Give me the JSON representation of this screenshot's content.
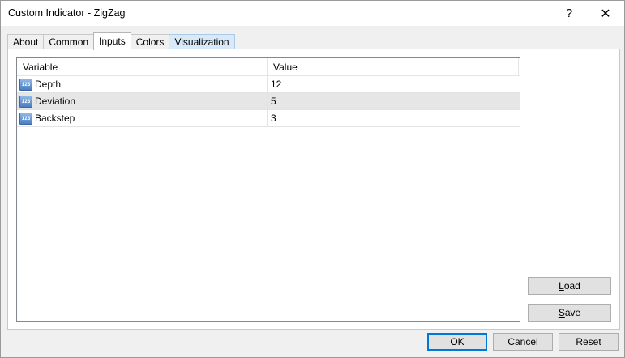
{
  "window": {
    "title": "Custom Indicator - ZigZag",
    "help_glyph": "?",
    "close_glyph": "✕"
  },
  "tabs": [
    {
      "label": "About"
    },
    {
      "label": "Common"
    },
    {
      "label": "Inputs",
      "active": true
    },
    {
      "label": "Colors"
    },
    {
      "label": "Visualization"
    }
  ],
  "grid": {
    "columns": {
      "variable": "Variable",
      "value": "Value"
    },
    "icon_text": "123",
    "rows": [
      {
        "variable": "Depth",
        "value": "12"
      },
      {
        "variable": "Deviation",
        "value": "5",
        "selected": true
      },
      {
        "variable": "Backstep",
        "value": "3"
      }
    ]
  },
  "side_buttons": {
    "load_prefix": "",
    "load_access": "L",
    "load_rest": "oad",
    "save_access": "S",
    "save_rest": "ave"
  },
  "footer": {
    "ok": "OK",
    "cancel": "Cancel",
    "reset": "Reset"
  },
  "colors": {
    "accent": "#0078d7",
    "tab_hover": "#d8eaf9",
    "selected_row": "#e6e6e6"
  }
}
